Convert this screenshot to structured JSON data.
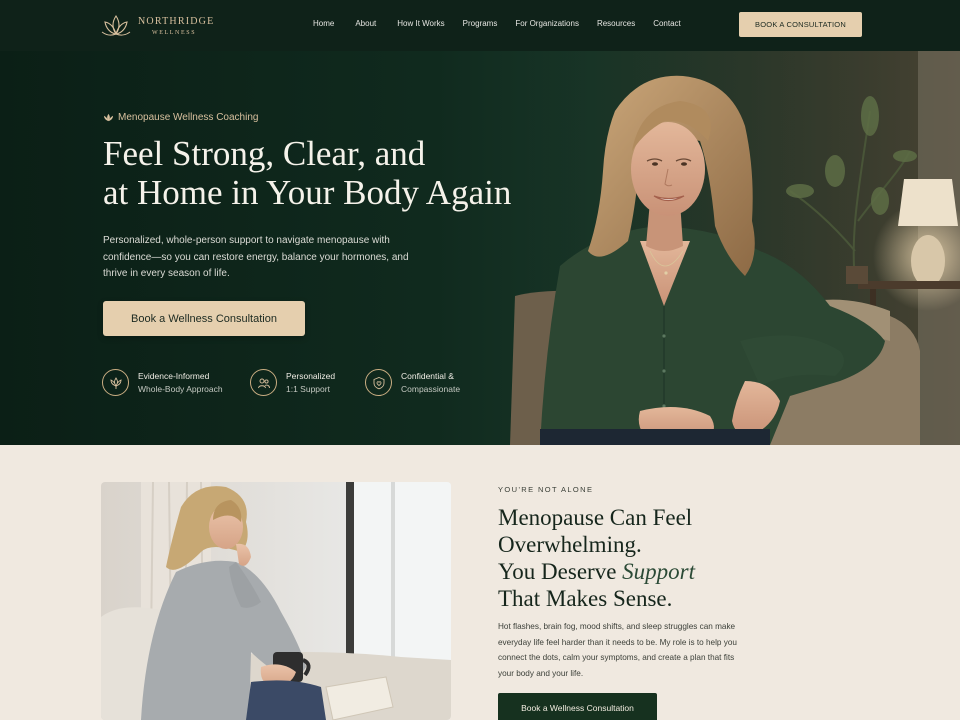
{
  "brand": {
    "name": "NORTHRIDGE",
    "sub": "WELLNESS"
  },
  "nav": {
    "links": [
      "Home",
      "About",
      "How It Works",
      "Programs",
      "For Organizations",
      "Resources",
      "Contact"
    ],
    "cta": "BOOK A CONSULTATION"
  },
  "hero": {
    "eyebrow": "Menopause Wellness Coaching",
    "title_line1": "Feel Strong, Clear, and",
    "title_line2": "at Home in Your Body Again",
    "description": "Personalized, whole-person support to navigate menopause with confidence—so you can restore energy, balance your hormones, and thrive in every season of life.",
    "button": "Book a Wellness Consultation",
    "features": [
      {
        "icon": "nature-icon",
        "line1": "Evidence-Informed",
        "line2": "Whole-Body Approach"
      },
      {
        "icon": "people-icon",
        "line1": "Personalized",
        "line2": "1:1 Support"
      },
      {
        "icon": "shield-icon",
        "line1": "Confidential &",
        "line2": "Compassionate"
      }
    ]
  },
  "section2": {
    "kicker": "YOU'RE NOT ALONE",
    "title_line1": "Menopause Can Feel",
    "title_line2": "Overwhelming.",
    "title_line3_pre": "You Deserve ",
    "title_line3_em": "Support",
    "title_line4": "That Makes Sense.",
    "description": "Hot flashes, brain fog, mood shifts, and sleep struggles can make everyday life feel harder than it needs to be. My role is to help you connect the dots, calm your symptoms, and create a plan that fits your body and your life.",
    "button": "Book a Wellness Consultation"
  },
  "colors": {
    "nav_bg": "#0f2219",
    "hero_bg": "#102a1e",
    "accent_gold": "#e5cfae",
    "section_bg": "#f0e9e0",
    "dark_green_button": "#16311f"
  }
}
